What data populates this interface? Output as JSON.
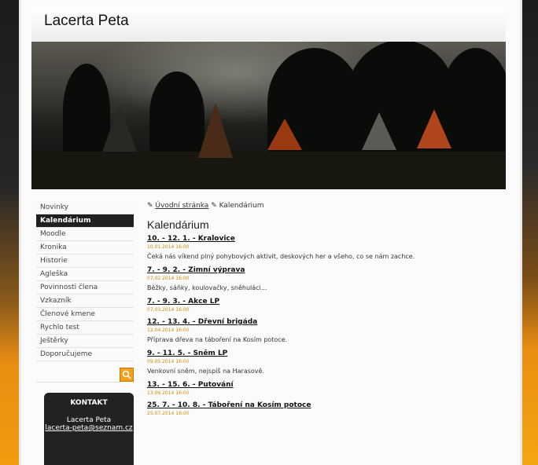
{
  "site": {
    "title": "Lacerta Peta"
  },
  "menu": [
    {
      "label": "Novinky"
    },
    {
      "label": "Kalendárium",
      "active": true
    },
    {
      "label": "Moodle"
    },
    {
      "label": "Kronika"
    },
    {
      "label": "Historie"
    },
    {
      "label": "Agleška"
    },
    {
      "label": "Povinnosti člena"
    },
    {
      "label": "Vzkazník"
    },
    {
      "label": "Členové kmene"
    },
    {
      "label": "Rychlo test"
    },
    {
      "label": "Ještěrky"
    },
    {
      "label": "Doporučujeme"
    }
  ],
  "search": {
    "placeholder": "",
    "icon": "search-icon"
  },
  "contact": {
    "title": "KONTAKT",
    "name": "Lacerta Peta",
    "email": "lacerta-peta@seznam.cz"
  },
  "breadcrumb": {
    "home": "Úvodní stránka",
    "current": "Kalendárium"
  },
  "page": {
    "title": "Kalendárium"
  },
  "events": [
    {
      "title": "10. - 12. 1. - Kralovice",
      "date": "10.01.2014 16:00",
      "desc": "Čeká nás víkend plný pohybových aktivit, deskových her a všeho, co se nám zachce."
    },
    {
      "title": "7. - 9. 2. - Zimní výprava",
      "date": "07.02.2014 16:00",
      "desc": "Běžky, sáňky, koulovačky, sněhuláci..."
    },
    {
      "title": "7. - 9. 3. - Akce LP",
      "date": "07.03.2014 16:00",
      "desc": ""
    },
    {
      "title": "12. - 13. 4. - Dřevní brigáda",
      "date": "12.04.2014 16:00",
      "desc": "Příprava dřeva na táboření na Kosím potoce."
    },
    {
      "title": "9. - 11. 5. - Sněm LP",
      "date": "09.05.2014 16:00",
      "desc": "Venkovní sněm, nejspíš na Harasově."
    },
    {
      "title": "13. - 15. 6. - Putování",
      "date": "13.06.2014 16:00",
      "desc": ""
    },
    {
      "title": "25. 7. - 10. 8. - Táboření na Kosím potoce",
      "date": "25.07.2014 16:00",
      "desc": ""
    }
  ],
  "colors": {
    "accent": "#e98d12",
    "active_menu": "#1f1f1f",
    "date": "#d08a00"
  }
}
